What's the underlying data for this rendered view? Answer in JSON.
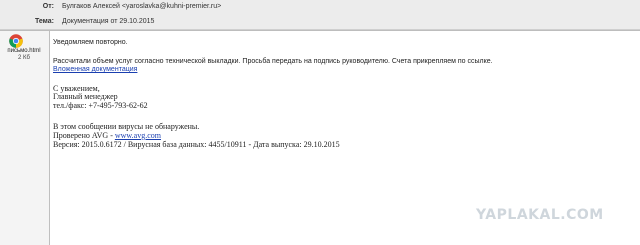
{
  "header": {
    "from_label": "От:",
    "from_value": "Булгаков Алексей <yaroslavka@kuhni-premier.ru>",
    "subject_label": "Тема:",
    "subject_value": "Документация от 29.10.2015"
  },
  "attachment": {
    "icon": "chrome-html-file-icon",
    "name": "письмо.html",
    "size": "2 Кб"
  },
  "body": {
    "line1": "Уведомляем повторно.",
    "line2": "Рассчитали объем услуг согласно технической выкладки. Просьба передать на подпись руководителю. Счета прикрепляем по ссылке.",
    "link_text": "Вложенная документация",
    "sig1": "С уважением,",
    "sig2": "Главный менеджер",
    "sig3": "тел./факс: +7-495-793-62-62",
    "av1": "В этом сообщении вирусы не обнаружены.",
    "av2_prefix": "Проверено AVG - ",
    "av2_link": "www.avg.com",
    "av3": "Версия: 2015.0.6172 / Вирусная база данных: 4455/10911 - Дата выпуска: 29.10.2015"
  },
  "watermark": "YAPLAKAL.COM"
}
